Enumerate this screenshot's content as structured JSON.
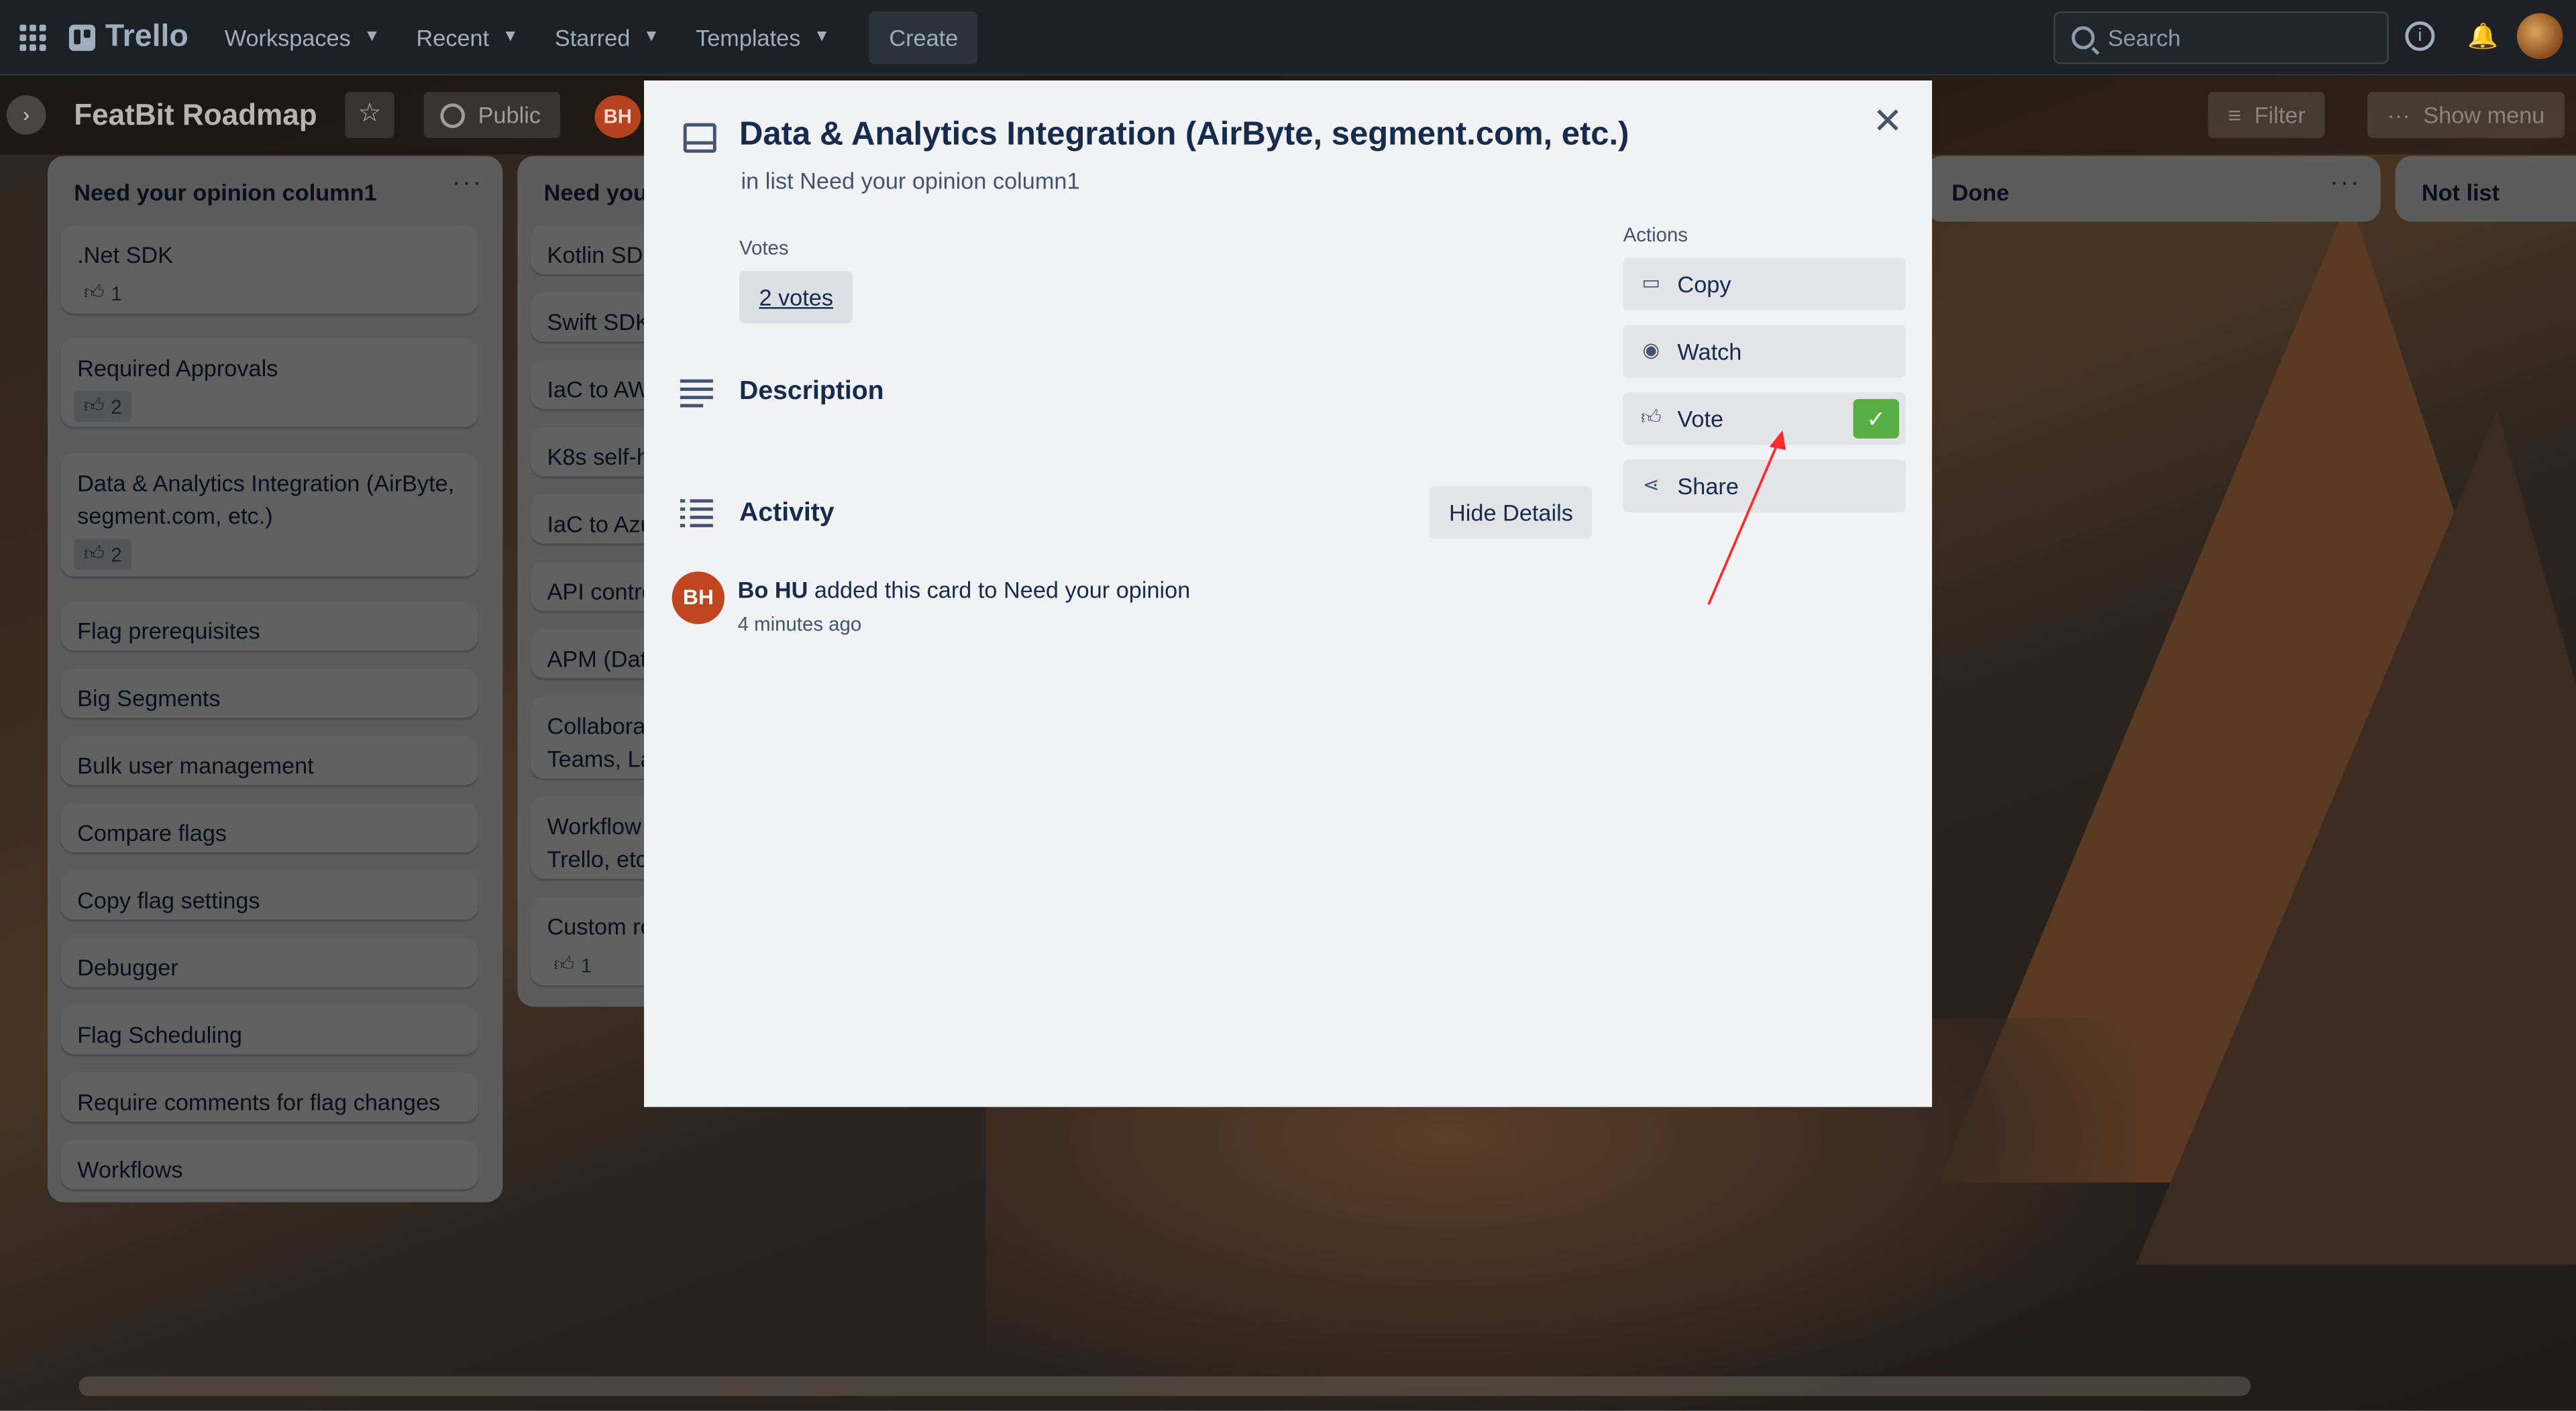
{
  "topnav": {
    "app_name": "Trello",
    "workspaces": "Workspaces",
    "recent": "Recent",
    "starred": "Starred",
    "templates": "Templates",
    "create": "Create",
    "search_placeholder": "Search"
  },
  "board": {
    "title": "FeatBit Roadmap",
    "visibility": "Public",
    "member_initials": "BH",
    "filter": "Filter",
    "show_menu": "Show menu"
  },
  "lists": [
    {
      "title": "Need your opinion column1",
      "cards": [
        {
          "title": ".Net SDK",
          "votes": "1"
        },
        {
          "title": "Required Approvals",
          "votes": "2"
        },
        {
          "title": "Data & Analytics Integration (AirByte, segment.com, etc.)",
          "votes": "2"
        },
        {
          "title": "Flag prerequisites"
        },
        {
          "title": "Big Segments"
        },
        {
          "title": "Bulk user management"
        },
        {
          "title": "Compare flags"
        },
        {
          "title": "Copy flag settings"
        },
        {
          "title": "Debugger"
        },
        {
          "title": "Flag Scheduling"
        },
        {
          "title": "Require comments for flag changes"
        },
        {
          "title": "Workflows"
        }
      ]
    },
    {
      "title": "Need you",
      "cards": [
        {
          "title": "Kotlin SDK"
        },
        {
          "title": "Swift SDK"
        },
        {
          "title": "IaC to AW"
        },
        {
          "title": "K8s self-h"
        },
        {
          "title": "IaC to Azu"
        },
        {
          "title": "API contro"
        },
        {
          "title": "APM (Dat"
        },
        {
          "title": "Collabora\nTeams, La"
        },
        {
          "title": "Workflow\nTrello, etc"
        },
        {
          "title": "Custom ro",
          "votes": "1"
        }
      ]
    },
    {
      "title": "Done"
    },
    {
      "title": "Not list"
    }
  ],
  "modal": {
    "title": "Data & Analytics Integration (AirByte, segment.com, etc.)",
    "in_list": "in list Need your opinion column1",
    "votes_label": "Votes",
    "votes_value": "2 votes",
    "description_title": "Description",
    "activity_title": "Activity",
    "hide_details": "Hide Details",
    "activity": {
      "user": "Bo HU",
      "initials": "BH",
      "action": "added this card to Need your opinion",
      "time": "4 minutes ago"
    },
    "actions_label": "Actions",
    "actions": {
      "copy": "Copy",
      "watch": "Watch",
      "vote": "Vote",
      "share": "Share"
    },
    "vote_checked": true
  },
  "colors": {
    "topbar": "#1d2125",
    "modal_bg": "#f1f2f4",
    "vote_check": "#5aac44",
    "avatar": "#c0461f",
    "annotation_arrow": "#ff2b2b"
  }
}
